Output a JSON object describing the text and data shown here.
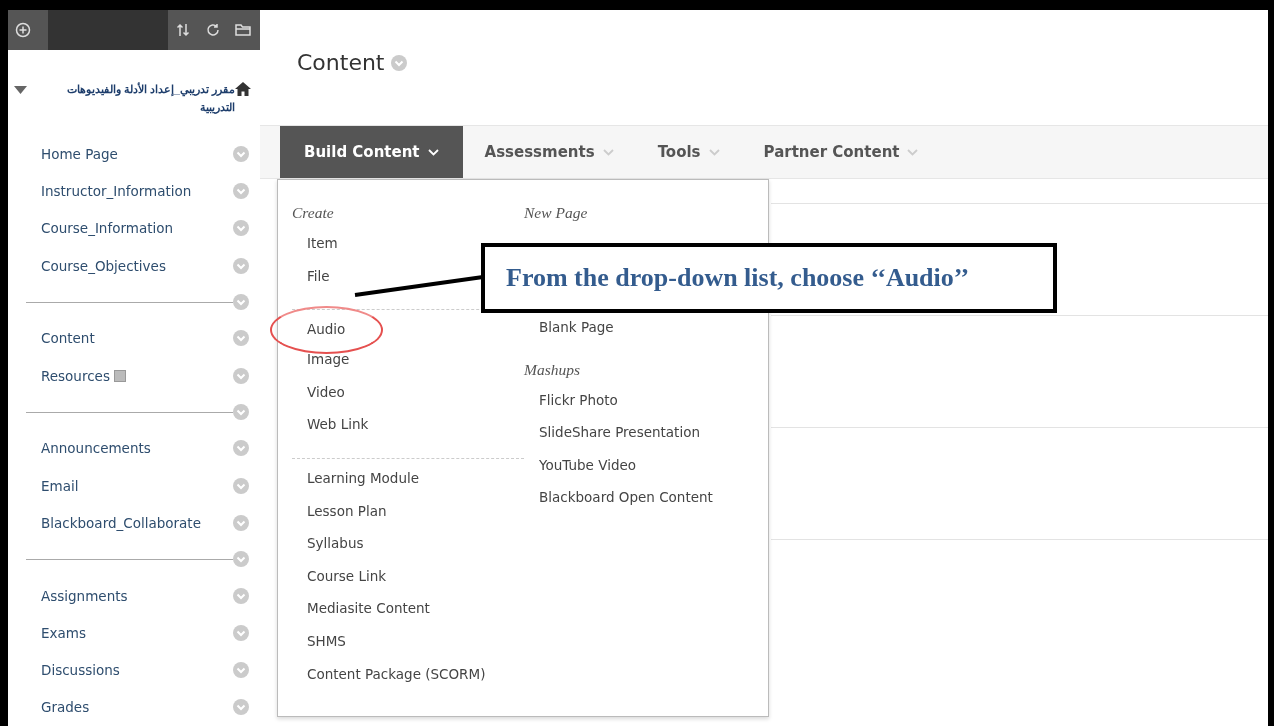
{
  "sidebar": {
    "course_title": "مقرر تدريبي_إعداد الأدلة والفيديوهات التدريبية",
    "expanded": true,
    "groups": [
      {
        "items": [
          {
            "label": "Home Page",
            "flag_icon": false
          },
          {
            "label": "Instructor_Information",
            "flag_icon": false
          },
          {
            "label": "Course_Information",
            "flag_icon": false
          },
          {
            "label": "Course_Objectives",
            "flag_icon": false
          }
        ]
      },
      {
        "items": [
          {
            "label": "Content",
            "flag_icon": false
          },
          {
            "label": "Resources",
            "flag_icon": true
          }
        ]
      },
      {
        "items": [
          {
            "label": "Announcements",
            "flag_icon": false
          },
          {
            "label": "Email",
            "flag_icon": false
          },
          {
            "label": "Blackboard_Collaborate",
            "flag_icon": false
          }
        ]
      },
      {
        "items": [
          {
            "label": "Assignments",
            "flag_icon": false
          },
          {
            "label": "Exams",
            "flag_icon": false
          },
          {
            "label": "Discussions",
            "flag_icon": false
          },
          {
            "label": "Grades",
            "flag_icon": false
          }
        ]
      }
    ]
  },
  "page_title": "Content",
  "tabs": [
    {
      "label": "Build Content",
      "selected": true
    },
    {
      "label": "Assessments",
      "selected": false
    },
    {
      "label": "Tools",
      "selected": false
    },
    {
      "label": "Partner Content",
      "selected": false
    }
  ],
  "menu": {
    "columns": [
      {
        "sections": [
          {
            "heading": "Create",
            "items": [
              {
                "label": "Item",
                "highlighted": false
              },
              {
                "label": "File",
                "highlighted": false
              }
            ]
          },
          {
            "items": [
              {
                "label": "Audio",
                "highlighted": true
              },
              {
                "label": "Image",
                "highlighted": false
              },
              {
                "label": "Video",
                "highlighted": false
              },
              {
                "label": "Web Link",
                "highlighted": false
              }
            ]
          },
          {
            "items": [
              {
                "label": "Learning Module",
                "highlighted": false
              },
              {
                "label": "Lesson Plan",
                "highlighted": false
              },
              {
                "label": "Syllabus",
                "highlighted": false
              },
              {
                "label": "Course Link",
                "highlighted": false
              },
              {
                "label": "Mediasite Content",
                "highlighted": false
              },
              {
                "label": "SHMS",
                "highlighted": false
              },
              {
                "label": "Content Package (SCORM)",
                "highlighted": false
              }
            ]
          }
        ]
      },
      {
        "sections": [
          {
            "heading": "New Page",
            "items": [
              {
                "label": "Blank Page",
                "highlighted": false
              }
            ]
          },
          {
            "heading": "Mashups",
            "items": [
              {
                "label": "Flickr Photo",
                "highlighted": false
              },
              {
                "label": "SlideShare Presentation",
                "highlighted": false
              },
              {
                "label": "YouTube Video",
                "highlighted": false
              },
              {
                "label": "Blackboard Open Content",
                "highlighted": false
              }
            ]
          }
        ]
      }
    ]
  },
  "callout": {
    "text": "From the drop-down list, choose ‘‘Audio’’"
  }
}
